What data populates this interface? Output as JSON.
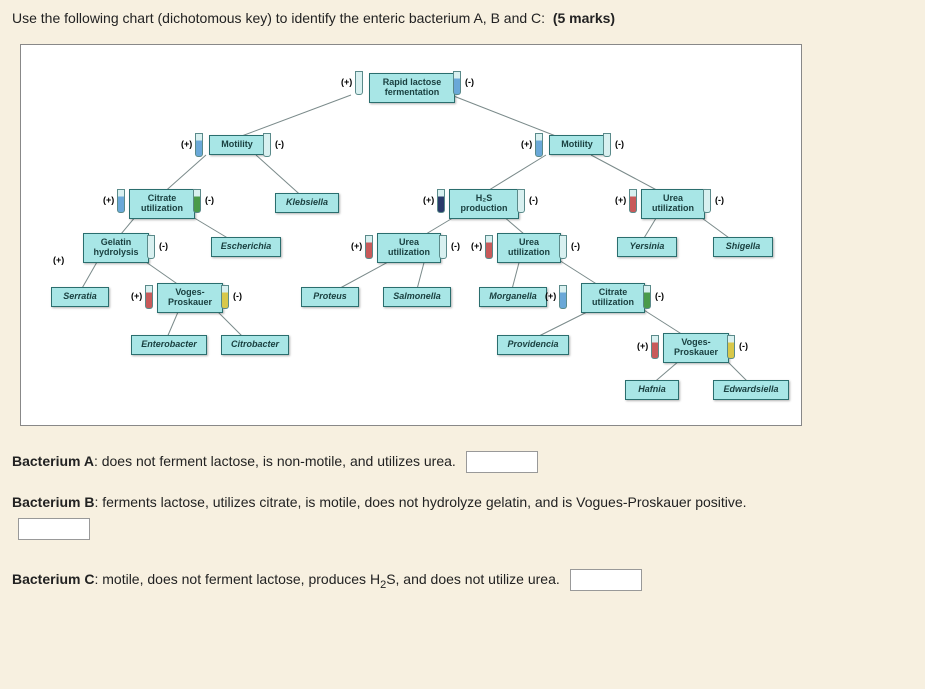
{
  "question": {
    "prefix": "Use the following chart (dichotomous key) to identify the enteric bacterium A, B and C:",
    "marks": "(5 marks)"
  },
  "chart_data": {
    "type": "tree",
    "root": {
      "label": "Rapid lactose fermentation",
      "pos": "(+) → left branch, (-) → right branch"
    },
    "nodes": [
      {
        "id": "root",
        "label": "Rapid lactose fermentation"
      },
      {
        "id": "mot_l",
        "label": "Motility",
        "from": "root",
        "edge": "(+)"
      },
      {
        "id": "mot_r",
        "label": "Motility",
        "from": "root",
        "edge": "(-)"
      },
      {
        "id": "citrate",
        "label": "Citrate utilization",
        "from": "mot_l",
        "edge": "(+)"
      },
      {
        "id": "klebsiella",
        "label": "Klebsiella",
        "from": "mot_l",
        "edge": "(-)",
        "leaf": true
      },
      {
        "id": "h2s",
        "label": "H₂S production",
        "from": "mot_r",
        "edge": "(+)"
      },
      {
        "id": "urea_r",
        "label": "Urea utilization",
        "from": "mot_r",
        "edge": "(-)"
      },
      {
        "id": "gelatin",
        "label": "Gelatin hydrolysis",
        "from": "citrate",
        "edge": "(+)"
      },
      {
        "id": "escherichia",
        "label": "Escherichia",
        "from": "citrate",
        "edge": "(-)",
        "leaf": true
      },
      {
        "id": "urea_m1",
        "label": "Urea utilization",
        "from": "h2s",
        "edge": "(+)"
      },
      {
        "id": "urea_m2",
        "label": "Urea utilization",
        "from": "h2s",
        "edge": "(-)"
      },
      {
        "id": "yersinia",
        "label": "Yersinia",
        "from": "urea_r",
        "edge": "(+)",
        "leaf": true
      },
      {
        "id": "shigella",
        "label": "Shigella",
        "from": "urea_r",
        "edge": "(-)",
        "leaf": true
      },
      {
        "id": "serratia",
        "label": "Serratia",
        "from": "gelatin",
        "edge": "(+)",
        "leaf": true
      },
      {
        "id": "vp_l",
        "label": "Voges-Proskauer",
        "from": "gelatin",
        "edge": "(-)"
      },
      {
        "id": "proteus",
        "label": "Proteus",
        "from": "urea_m1",
        "edge": "(+)",
        "leaf": true
      },
      {
        "id": "salmonella",
        "label": "Salmonella",
        "from": "urea_m1",
        "edge": "(-)",
        "leaf": true
      },
      {
        "id": "morganella",
        "label": "Morganella",
        "from": "urea_m2",
        "edge": "(+)",
        "leaf": true
      },
      {
        "id": "citrate_r",
        "label": "Citrate utilization",
        "from": "urea_m2",
        "edge": "(-)"
      },
      {
        "id": "enterobacter",
        "label": "Enterobacter",
        "from": "vp_l",
        "edge": "(+)",
        "leaf": true
      },
      {
        "id": "citrobacter",
        "label": "Citrobacter",
        "from": "vp_l",
        "edge": "(-)",
        "leaf": true
      },
      {
        "id": "providencia",
        "label": "Providencia",
        "from": "citrate_r",
        "edge": "(+)",
        "leaf": true
      },
      {
        "id": "vp_r",
        "label": "Voges-Proskauer",
        "from": "citrate_r",
        "edge": "(-)"
      },
      {
        "id": "hafnia",
        "label": "Hafnia",
        "from": "vp_r",
        "edge": "(+)",
        "leaf": true
      },
      {
        "id": "edwardsiella",
        "label": "Edwardsiella",
        "from": "vp_r",
        "edge": "(-)",
        "leaf": true
      }
    ]
  },
  "labels": {
    "root": "Rapid lactose fermentation",
    "motility": "Motility",
    "citrate": "Citrate utilization",
    "klebsiella": "Klebsiella",
    "h2s": "H₂S production",
    "urea": "Urea utilization",
    "gelatin": "Gelatin hydrolysis",
    "escherichia": "Escherichia",
    "yersinia": "Yersinia",
    "shigella": "Shigella",
    "serratia": "Serratia",
    "vp": "Voges-Proskauer",
    "proteus": "Proteus",
    "salmonella": "Salmonella",
    "morganella": "Morganella",
    "enterobacter": "Enterobacter",
    "citrobacter": "Citrobacter",
    "providencia": "Providencia",
    "hafnia": "Hafnia",
    "edwardsiella": "Edwardsiella",
    "plus": "(+)",
    "minus": "(-)"
  },
  "bacteria": {
    "a_label": "Bacterium A",
    "a_desc": ": does not ferment lactose, is non-motile, and utilizes urea.",
    "b_label": "Bacterium B",
    "b_desc": ": ferments lactose, utilizes citrate, is motile, does not hydrolyze gelatin, and is Vogues-Proskauer positive.",
    "c_label": "Bacterium C",
    "c_desc_pre": ": motile, does not ferment lactose, produces H",
    "c_desc_sub": "2",
    "c_desc_post": "S, and does not utilize urea."
  }
}
